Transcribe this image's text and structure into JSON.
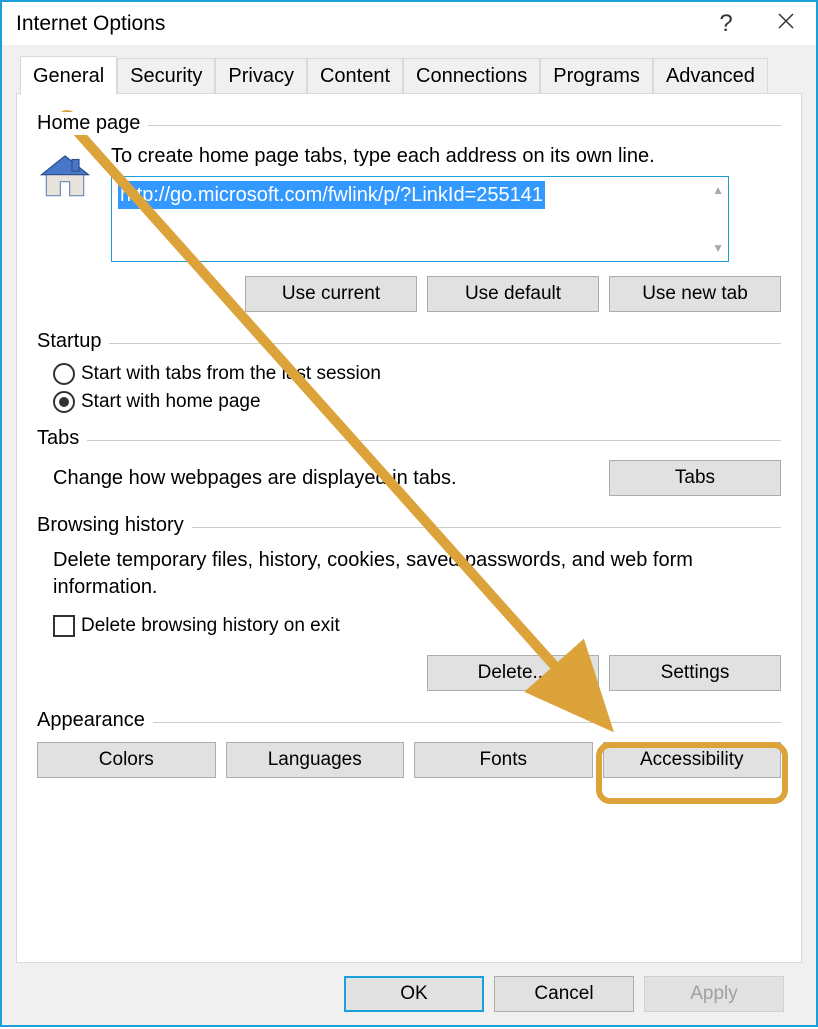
{
  "title": "Internet Options",
  "tabs": [
    "General",
    "Security",
    "Privacy",
    "Content",
    "Connections",
    "Programs",
    "Advanced"
  ],
  "active_tab": 0,
  "homepage": {
    "label": "Home page",
    "instruction": "To create home page tabs, type each address on its own line.",
    "url": "http://go.microsoft.com/fwlink/p/?LinkId=255141",
    "buttons": {
      "use_current": "Use current",
      "use_default": "Use default",
      "use_new_tab": "Use new tab"
    }
  },
  "startup": {
    "label": "Startup",
    "options": [
      {
        "label": "Start with tabs from the last session",
        "selected": false
      },
      {
        "label": "Start with home page",
        "selected": true
      }
    ]
  },
  "tabs_section": {
    "label": "Tabs",
    "desc": "Change how webpages are displayed in tabs.",
    "button": "Tabs"
  },
  "history": {
    "label": "Browsing history",
    "desc": "Delete temporary files, history, cookies, saved passwords, and web form information.",
    "checkbox": "Delete browsing history on exit",
    "delete": "Delete...",
    "settings": "Settings"
  },
  "appearance": {
    "label": "Appearance",
    "buttons": {
      "colors": "Colors",
      "languages": "Languages",
      "fonts": "Fonts",
      "accessibility": "Accessibility"
    }
  },
  "footer": {
    "ok": "OK",
    "cancel": "Cancel",
    "apply": "Apply"
  }
}
